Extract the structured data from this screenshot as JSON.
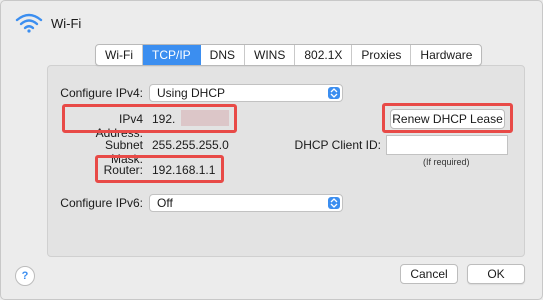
{
  "window": {
    "title": "Wi-Fi",
    "icon": "wifi-icon"
  },
  "tabs": [
    {
      "label": "Wi-Fi",
      "active": false
    },
    {
      "label": "TCP/IP",
      "active": true
    },
    {
      "label": "DNS",
      "active": false
    },
    {
      "label": "WINS",
      "active": false
    },
    {
      "label": "802.1X",
      "active": false
    },
    {
      "label": "Proxies",
      "active": false
    },
    {
      "label": "Hardware",
      "active": false
    }
  ],
  "ipv4": {
    "configure_label": "Configure IPv4:",
    "configure_value": "Using DHCP",
    "address_label": "IPv4 Address:",
    "address_value": "192.",
    "subnet_label": "Subnet Mask:",
    "subnet_value": "255.255.255.0",
    "router_label": "Router:",
    "router_value": "192.168.1.1"
  },
  "dhcp": {
    "renew_label": "Renew DHCP Lease",
    "client_id_label": "DHCP Client ID:",
    "client_id_value": "",
    "client_id_hint": "(If required)"
  },
  "ipv6": {
    "configure_label": "Configure IPv6:",
    "configure_value": "Off"
  },
  "footer": {
    "help_label": "?",
    "cancel_label": "Cancel",
    "ok_label": "OK"
  },
  "colors": {
    "accent": "#3b8ef0",
    "highlight": "#e84a47",
    "window_bg": "#ececec"
  }
}
